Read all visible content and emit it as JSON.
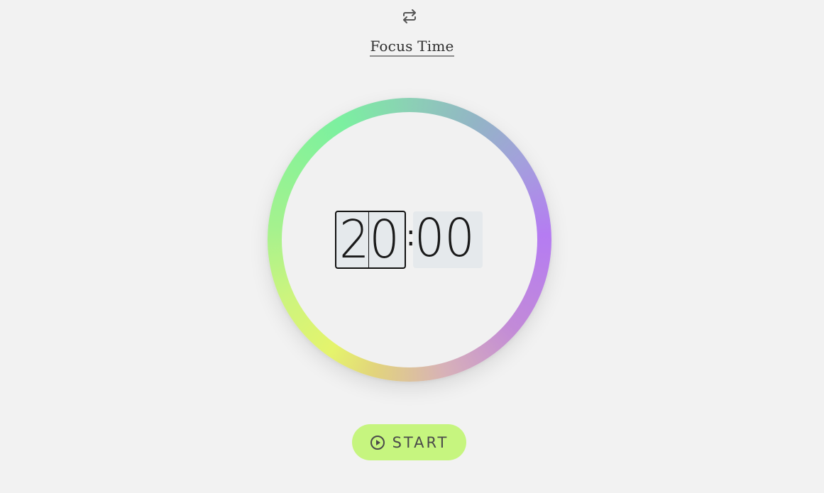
{
  "header": {
    "swap_icon": "repeat-arrows-icon",
    "mode_title": "Focus Time"
  },
  "timer": {
    "minutes": "20",
    "separator": ":",
    "seconds": "00",
    "ring_colors": [
      "#7bf0a0",
      "#b57cf2",
      "#e5f46c",
      "#d7b1b8"
    ]
  },
  "controls": {
    "start_label": "START",
    "start_icon": "play-circle-icon",
    "start_color": "#c6f57f"
  }
}
